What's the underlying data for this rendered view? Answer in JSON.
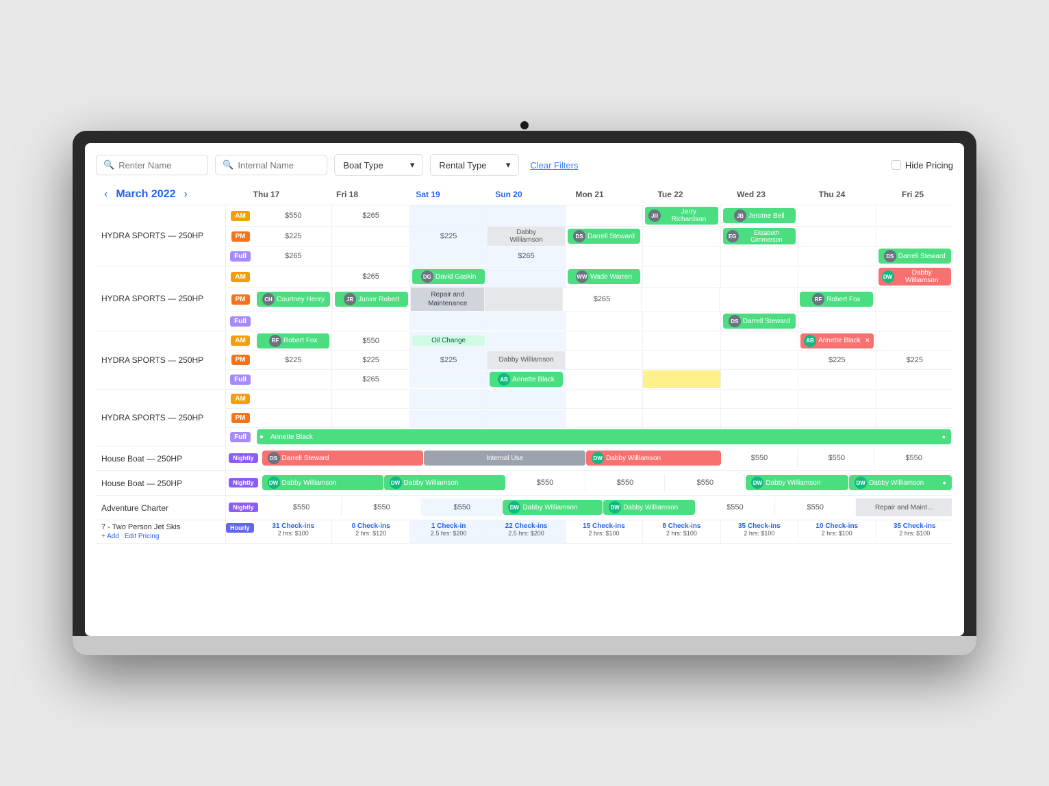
{
  "toolbar": {
    "renter_placeholder": "Renter Name",
    "internal_placeholder": "Internal Name",
    "boat_type_label": "Boat Type",
    "rental_type_label": "Rental Type",
    "clear_filters_label": "Clear Filters",
    "hide_pricing_label": "Hide Pricing"
  },
  "calendar": {
    "month_year": "March 2022",
    "days": [
      {
        "label": "Thu 17",
        "num": "17",
        "day": "Thu"
      },
      {
        "label": "Fri 18",
        "num": "18",
        "day": "Fri"
      },
      {
        "label": "Sat 19",
        "num": "19",
        "day": "Sat"
      },
      {
        "label": "Sun 20",
        "num": "20",
        "day": "Sun"
      },
      {
        "label": "Mon 21",
        "num": "21",
        "day": "Mon"
      },
      {
        "label": "Tue 22",
        "num": "22",
        "day": "Tue"
      },
      {
        "label": "Wed 23",
        "num": "23",
        "day": "Wed"
      },
      {
        "label": "Thu 24",
        "num": "24",
        "day": "Thu"
      },
      {
        "label": "Fri 25",
        "num": "25",
        "day": "Fri"
      }
    ]
  },
  "boats": [
    {
      "name": "HYDRA SPORTS — 250HP",
      "rows": [
        {
          "badge": "AM",
          "badge_type": "am",
          "cells": [
            "$550",
            "$265",
            "",
            "",
            "",
            "",
            "",
            "",
            ""
          ]
        },
        {
          "badge": "PM",
          "badge_type": "pm",
          "cells": [
            "$225",
            "",
            "$225",
            "",
            "Dabby Williamson",
            "Darrell Steward",
            "",
            "",
            ""
          ]
        },
        {
          "badge": "Full",
          "badge_type": "full",
          "cells": [
            "$265",
            "",
            "",
            "$265",
            "",
            "",
            "",
            "",
            "Darrell Steward"
          ]
        }
      ]
    },
    {
      "name": "HYDRA SPORTS — 250HP",
      "rows": [
        {
          "badge": "AM",
          "badge_type": "am",
          "cells": [
            "",
            "$265",
            "David Gaskin",
            "",
            "Wade Warren",
            "",
            "",
            "",
            "Dabby Williamson"
          ]
        },
        {
          "badge": "PM",
          "badge_type": "pm",
          "cells": [
            "Courtney Henry",
            "Junior Robert",
            "Repair and Maintenance",
            "",
            "$265",
            "",
            "",
            "Robert Fox",
            ""
          ]
        },
        {
          "badge": "Full",
          "badge_type": "full",
          "cells": [
            "",
            "",
            "",
            "",
            "",
            "",
            "Darrell Steward",
            "",
            ""
          ]
        }
      ]
    },
    {
      "name": "HYDRA SPORTS — 250HP",
      "rows": [
        {
          "badge": "AM",
          "badge_type": "am",
          "cells": [
            "Robert Fox",
            "$550",
            "Oil Change",
            "",
            "",
            "",
            "",
            "Annette Black",
            ""
          ]
        },
        {
          "badge": "PM",
          "badge_type": "pm",
          "cells": [
            "$225",
            "$225",
            "$225",
            "Dabby Williamson",
            "",
            "",
            "",
            "$225",
            "$225"
          ]
        },
        {
          "badge": "Full",
          "badge_type": "full",
          "cells": [
            "",
            "$265",
            "",
            "Annette Black",
            "",
            "",
            "",
            "",
            ""
          ]
        }
      ]
    },
    {
      "name": "HYDRA SPORTS — 250HP",
      "rows": [
        {
          "badge": "AM",
          "badge_type": "am",
          "cells": [
            "",
            "",
            "",
            "",
            "",
            "",
            "",
            "",
            ""
          ]
        },
        {
          "badge": "PM",
          "badge_type": "pm",
          "cells": [
            "",
            "",
            "",
            "",
            "",
            "",
            "",
            "",
            ""
          ]
        },
        {
          "badge": "Full",
          "badge_type": "full",
          "cells_span": "Annette Black"
        }
      ]
    },
    {
      "name": "House Boat — 250HP",
      "type": "nightly",
      "row_span": [
        "Darrell Steward",
        "Internal Use",
        "Dabby Williamson",
        "$550",
        "$550",
        "$550"
      ]
    },
    {
      "name": "House Boat — 250HP",
      "type": "nightly",
      "row_span2": [
        "Dabby Williamson",
        "Dabby Williamson",
        "$550",
        "$550",
        "$550",
        "Dabby Williamson",
        "Dabby Williamson"
      ]
    },
    {
      "name": "Adventure Charter",
      "type": "nightly",
      "row_span3": [
        "$550",
        "$550",
        "$550",
        "Dabby Williamson",
        "Dabby Williamson",
        "$550",
        "$550",
        "Repair and Maint..."
      ]
    }
  ],
  "jetski": {
    "name": "7 - Two Person Jet Skis",
    "add_label": "+ Add",
    "edit_pricing_label": "Edit Pricing",
    "type": "hourly",
    "checkins": [
      {
        "count": "31",
        "label": "Check-ins",
        "detail": "2 hrs: $100"
      },
      {
        "count": "0",
        "label": "Check-ins",
        "detail": "2 hrs: $120"
      },
      {
        "count": "1",
        "label": "Check-in",
        "detail": "2.5 hrs: $200"
      },
      {
        "count": "22",
        "label": "Check-ins",
        "detail": "2.5 hrs: $200"
      },
      {
        "count": "15",
        "label": "Check-ins",
        "detail": "2 hrs: $100"
      },
      {
        "count": "8",
        "label": "Check-ins",
        "detail": "2 hrs: $100"
      },
      {
        "count": "35",
        "label": "Check-ins",
        "detail": "2 hrs: $100"
      },
      {
        "count": "10",
        "label": "Check-ins",
        "detail": "2 hrs: $100"
      },
      {
        "count": "35",
        "label": "Check-ins",
        "detail": "2 hrs: $100"
      }
    ]
  }
}
